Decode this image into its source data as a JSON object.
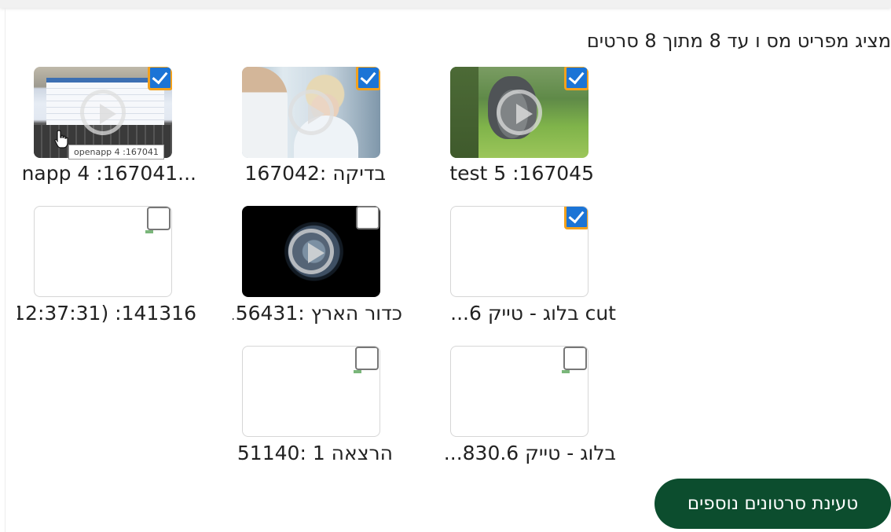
{
  "status_text": "מציג מפריט מס ו עד 8 מתוך 8 סרטים",
  "videos": [
    {
      "caption": "test 5 :167045",
      "checked": true,
      "thumbnail": "animated-bunny-frame",
      "has_play_icon": true
    },
    {
      "caption": "בדיקה :167042",
      "checked": true,
      "thumbnail": "lab-scientists-frame",
      "has_play_icon": true
    },
    {
      "caption": "...enapp 4 :167041",
      "checked": true,
      "thumbnail": "laptop-keyboard-frame",
      "has_play_icon": true
    },
    {
      "caption": "cut בלוג - טייק 6...",
      "checked": true,
      "thumbnail": "blank",
      "has_play_icon": false
    },
    {
      "caption": "כדור הארץ :156431",
      "checked": false,
      "thumbnail": "earth-from-space-frame",
      "has_play_icon": true
    },
    {
      "caption": "141316: (12:37:31 ...",
      "checked": false,
      "thumbnail": "blank",
      "has_play_icon": false
    },
    {
      "caption": "בלוג - טייק 830.6...",
      "checked": false,
      "thumbnail": "blank",
      "has_play_icon": false
    },
    {
      "caption": "הרצאה 1 :51140",
      "checked": false,
      "thumbnail": "blank",
      "has_play_icon": false
    }
  ],
  "tooltip": "openapp 4 :167041",
  "load_more_label": "טעינת סרטונים נוספים",
  "colors": {
    "checkbox_checked": "#1b74d6",
    "checkbox_focus_border": "#f3a11c",
    "button_background": "#0c4d2e",
    "button_text": "#ffffff"
  },
  "icons": {
    "play": "play-circle-icon",
    "checkbox_checked": "checkbox-checked-icon",
    "checkbox_unchecked": "checkbox-unchecked-icon",
    "cursor": "hand-pointer-cursor-icon"
  }
}
